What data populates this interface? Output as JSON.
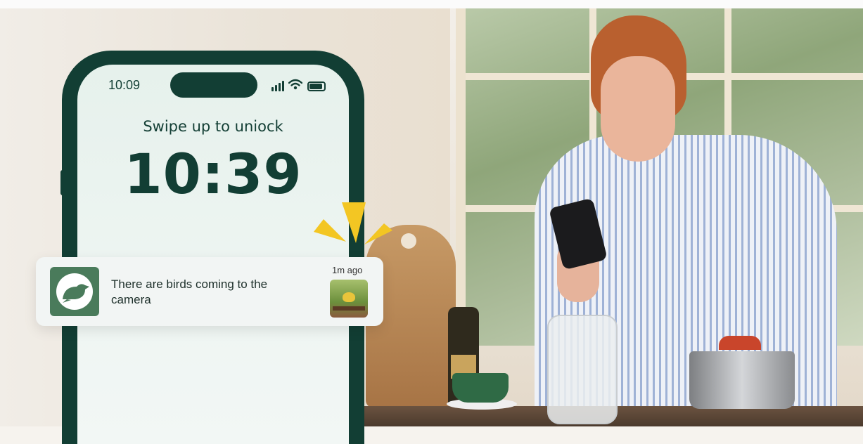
{
  "phone": {
    "status_time": "10:09",
    "lock_prompt": "Swipe up to uniock",
    "clock": "10:39"
  },
  "notification": {
    "message": "There are birds coming to the camera",
    "age": "1m ago",
    "app_icon": "bird-icon",
    "thumbnail": "bird-at-feeder-thumbnail"
  },
  "colors": {
    "phone_body": "#123e34",
    "app_icon_bg": "#4a7b5b",
    "spark_accent": "#f3c623"
  },
  "icons": [
    "cellular-signal-icon",
    "wifi-icon",
    "battery-icon",
    "bird-icon",
    "spark-icon"
  ]
}
